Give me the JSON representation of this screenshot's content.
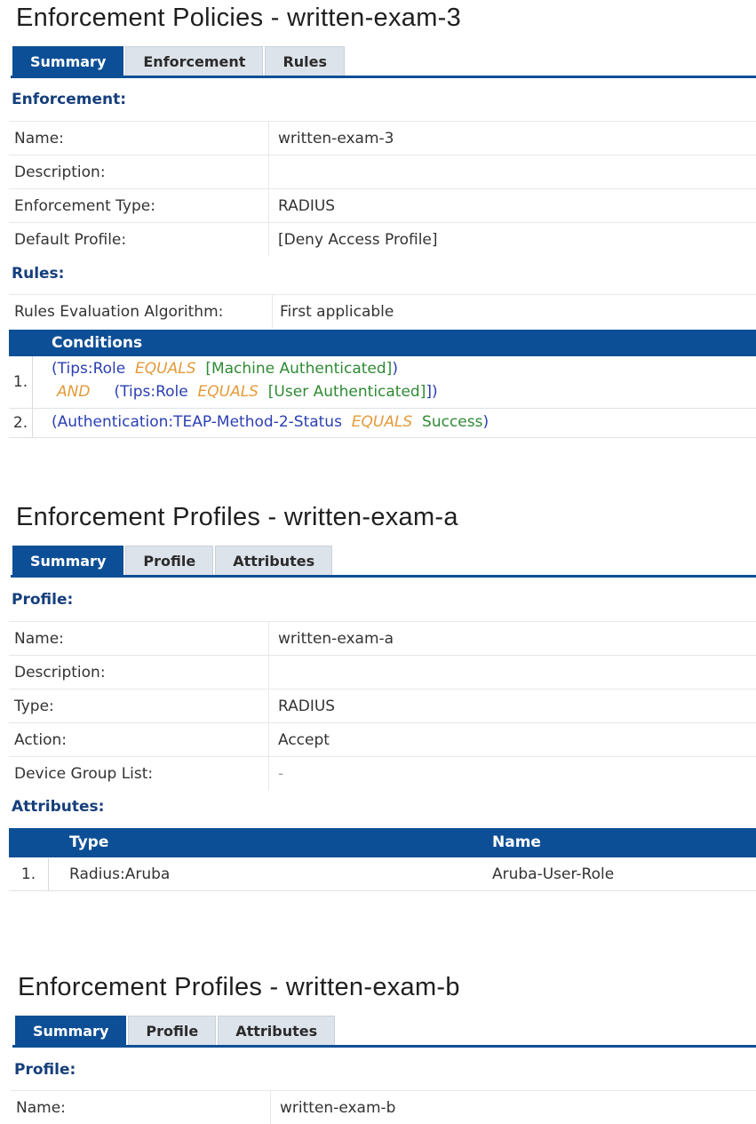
{
  "policy": {
    "title": "Enforcement Policies - written-exam-3",
    "tabs": [
      "Summary",
      "Enforcement",
      "Rules"
    ],
    "enforcement_heading": "Enforcement:",
    "fields": [
      {
        "label": "Name:",
        "value": "written-exam-3"
      },
      {
        "label": "Description:",
        "value": ""
      },
      {
        "label": "Enforcement Type:",
        "value": "RADIUS"
      },
      {
        "label": "Default Profile:",
        "value": "[Deny Access Profile]"
      }
    ],
    "rules_heading": "Rules:",
    "algorithm_label": "Rules Evaluation Algorithm:",
    "algorithm_value": "First applicable",
    "conditions_header": "Conditions",
    "rules": [
      {
        "num": "1.",
        "line1": {
          "open": "(",
          "key": "Tips:Role",
          "op": "EQUALS",
          "val": "[Machine Authenticated]",
          "close": ")"
        },
        "line2": {
          "join": "AND",
          "open": "(",
          "key": "Tips:Role",
          "op": "EQUALS",
          "val": "[User Authenticated]",
          "close": "])"
        }
      },
      {
        "num": "2.",
        "line1": {
          "open": "(",
          "key": "Authentication:TEAP-Method-2-Status",
          "op": "EQUALS",
          "val": "Success",
          "close": ")"
        }
      }
    ]
  },
  "profile_a": {
    "title": "Enforcement Profiles - written-exam-a",
    "tabs": [
      "Summary",
      "Profile",
      "Attributes"
    ],
    "profile_heading": "Profile:",
    "fields": [
      {
        "label": "Name:",
        "value": "written-exam-a"
      },
      {
        "label": "Description:",
        "value": ""
      },
      {
        "label": "Type:",
        "value": "RADIUS"
      },
      {
        "label": "Action:",
        "value": "Accept"
      },
      {
        "label": "Device Group List:",
        "value": "-"
      }
    ],
    "attributes_heading": "Attributes:",
    "attr_columns": [
      "Type",
      "Name"
    ],
    "attributes": [
      {
        "num": "1.",
        "type": "Radius:Aruba",
        "name": "Aruba-User-Role"
      }
    ]
  },
  "profile_b": {
    "title": "Enforcement Profiles - written-exam-b",
    "tabs": [
      "Summary",
      "Profile",
      "Attributes"
    ],
    "profile_heading": "Profile:",
    "fields": [
      {
        "label": "Name:",
        "value": "written-exam-b"
      }
    ]
  },
  "colors": {
    "accent": "#0d4f96",
    "heading": "#163f7c",
    "condition_key": "#2a3fb3",
    "condition_operator": "#e49b3a",
    "condition_value": "#2f8a34"
  }
}
